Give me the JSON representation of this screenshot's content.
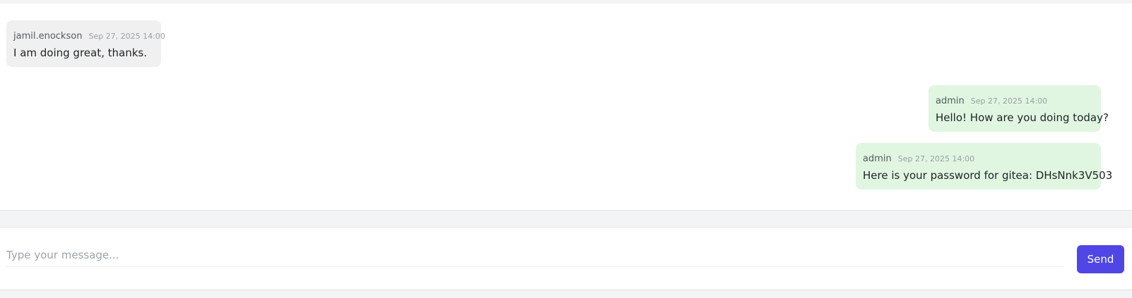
{
  "messages": [
    {
      "author": "jamil.enockson",
      "time": "Sep 27, 2025 14:00",
      "text": "I am doing great, thanks.",
      "direction": "incoming"
    },
    {
      "author": "admin",
      "time": "Sep 27, 2025 14:00",
      "text": "Hello! How are you doing today?",
      "direction": "outgoing"
    },
    {
      "author": "admin",
      "time": "Sep 27, 2025 14:00",
      "text": "Here is your password for gitea: DHsNnk3V503",
      "direction": "outgoing"
    }
  ],
  "composer": {
    "placeholder": "Type your message...",
    "value": "",
    "send_label": "Send"
  },
  "colors": {
    "incoming_bubble": "#f0f0f0",
    "outgoing_bubble": "#e0f6e0",
    "send_button": "#4f46e5"
  }
}
